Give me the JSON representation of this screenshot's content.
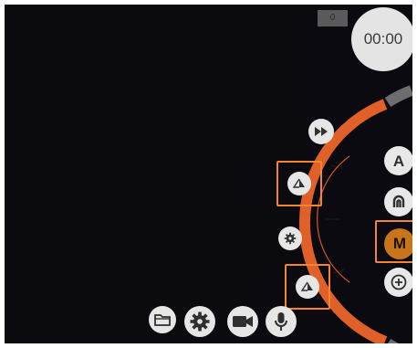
{
  "status": {
    "counter": "0",
    "timer": "00:00"
  },
  "mode_dial": {
    "accent_color": "#e0602a",
    "track_color": "#6d6d6d",
    "buttons": [
      {
        "id": "auto",
        "label": "A"
      },
      {
        "id": "manual",
        "label": "M",
        "selected": true
      }
    ]
  },
  "side_controls": {
    "icons": [
      "fast-forward-icon",
      "shutter-icon",
      "settings-icon",
      "shutter-icon"
    ]
  },
  "bottom_toolbar": {
    "icons": [
      "folder-icon",
      "gear-icon",
      "video-camera-icon",
      "microphone-icon"
    ]
  },
  "colors": {
    "highlight": "#f2852e",
    "background": "#0b0a10",
    "button": "#e8e8e8"
  }
}
